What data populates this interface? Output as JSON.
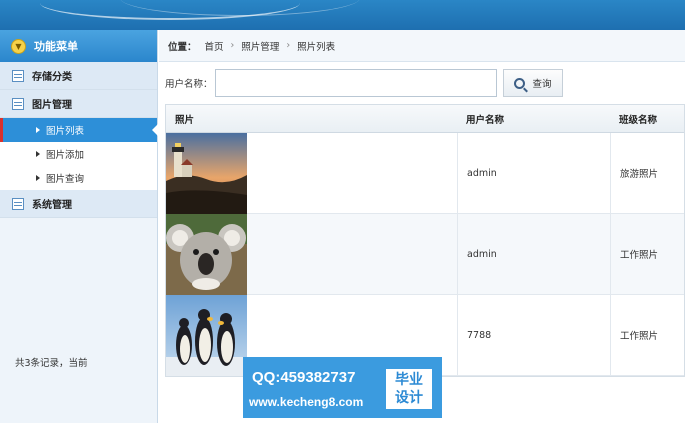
{
  "sidebar": {
    "header": "功能菜单",
    "groups": [
      {
        "label": "存储分类"
      },
      {
        "label": "图片管理"
      },
      {
        "label": "系统管理"
      }
    ],
    "subitems": [
      {
        "label": "图片列表"
      },
      {
        "label": "图片添加"
      },
      {
        "label": "图片查询"
      }
    ]
  },
  "breadcrumb": {
    "label": "位置：",
    "items": [
      "首页",
      "照片管理",
      "照片列表"
    ]
  },
  "search": {
    "label": "用户名称：",
    "value": "",
    "button": "查询"
  },
  "table": {
    "headers": [
      "照片",
      "用户名称",
      "班级名称"
    ],
    "rows": [
      {
        "photo": "lighthouse-photo",
        "user": "admin",
        "class": "旅游照片"
      },
      {
        "photo": "koala-photo",
        "user": "admin",
        "class": "工作照片"
      },
      {
        "photo": "penguins-photo",
        "user": "7788",
        "class": "工作照片"
      }
    ]
  },
  "footer": {
    "text": "共3条记录，当前"
  },
  "watermark": {
    "qq": "QQ:459382737",
    "site": "www.kecheng8.com",
    "tag1": "毕业",
    "tag2": "设计"
  }
}
